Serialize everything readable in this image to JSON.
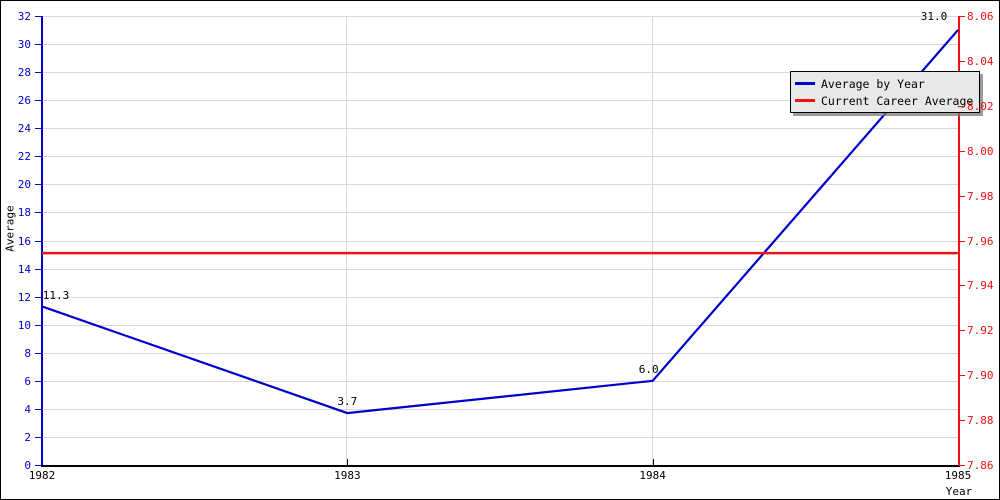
{
  "chart_data": {
    "type": "line",
    "title": "",
    "xlabel": "Year",
    "ylabel": "Average",
    "y2label": "",
    "x": [
      1982,
      1983,
      1984,
      1985
    ],
    "xlim": [
      1982,
      1985
    ],
    "ylim": [
      0,
      32
    ],
    "y2lim": [
      7.86,
      8.06
    ],
    "grid": true,
    "legend_position": "top-right",
    "series": [
      {
        "name": "Average by Year",
        "color": "#0000cc",
        "axis": "left",
        "values": [
          11.3,
          3.7,
          6.0,
          31.0
        ],
        "point_labels": [
          "11.3",
          "3.7",
          "6.0",
          "31.0"
        ]
      },
      {
        "name": "Current Career Average",
        "color": "#ee1111",
        "axis": "left",
        "type": "hline",
        "value": 15.1
      }
    ],
    "x_ticks": [
      "1982",
      "1983",
      "1984",
      "1985"
    ],
    "y_ticks": [
      "0",
      "2",
      "4",
      "6",
      "8",
      "10",
      "12",
      "14",
      "16",
      "18",
      "20",
      "22",
      "24",
      "26",
      "28",
      "30",
      "32"
    ],
    "y2_ticks": [
      "7.86",
      "7.88",
      "7.90",
      "7.92",
      "7.94",
      "7.96",
      "7.98",
      "8.00",
      "8.02",
      "8.04",
      "8.06"
    ]
  },
  "axes": {
    "left_axis_color": "#0000cc",
    "right_axis_color": "#ee1111",
    "bottom_axis_color": "#000000",
    "grid_color": "#d9d9d9",
    "background": "#ffffff"
  },
  "legend": {
    "entries": [
      {
        "label": "Average by Year",
        "color": "#0000cc"
      },
      {
        "label": "Current Career Average",
        "color": "#ee1111"
      }
    ]
  }
}
